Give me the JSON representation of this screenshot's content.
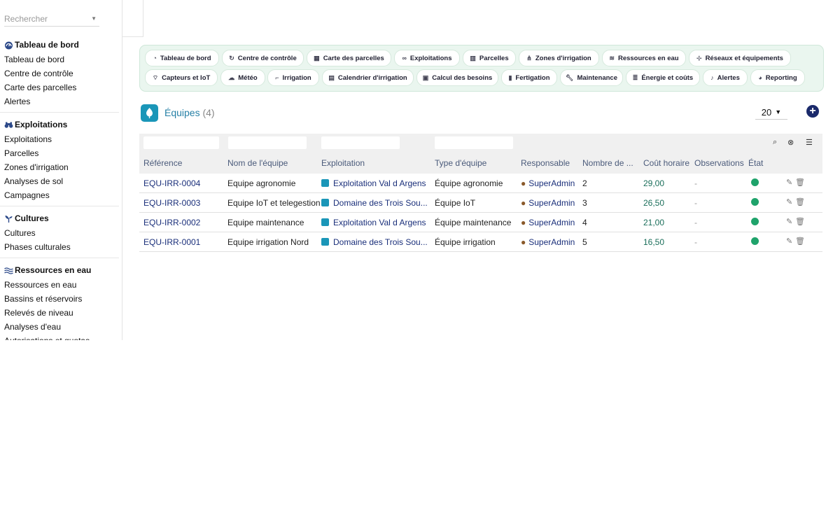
{
  "sidebar": {
    "search_placeholder": "Rechercher",
    "sections": [
      {
        "title": "Tableau de bord",
        "icon": "dashboard-icon",
        "items": [
          "Tableau de bord",
          "Centre de contrôle",
          "Carte des parcelles",
          "Alertes"
        ]
      },
      {
        "title": "Exploitations",
        "icon": "binoculars-icon",
        "items": [
          "Exploitations",
          "Parcelles",
          "Zones d'irrigation",
          "Analyses de sol",
          "Campagnes"
        ]
      },
      {
        "title": "Cultures",
        "icon": "seedling-icon",
        "items": [
          "Cultures",
          "Phases culturales"
        ]
      },
      {
        "title": "Ressources en eau",
        "icon": "water-icon",
        "items": [
          "Ressources en eau",
          "Bassins et réservoirs",
          "Relevés de niveau",
          "Analyses d'eau",
          "Autorisations et quotas"
        ]
      }
    ]
  },
  "nav": {
    "row1": [
      "Tableau de bord",
      "Centre de contrôle",
      "Carte des parcelles",
      "Exploitations",
      "Parcelles",
      "Zones d'irrigation",
      "Ressources en eau",
      "Réseaux et équipements"
    ],
    "row2": [
      "Capteurs et IoT",
      "Météo",
      "Irrigation",
      "Calendrier d'irrigation",
      "Calcul des besoins",
      "Fertigation",
      "Maintenance",
      "Énergie et coûts",
      "Alertes",
      "Reporting"
    ]
  },
  "page": {
    "title": "Équipes",
    "count": "(4)",
    "page_size": "20"
  },
  "table": {
    "columns": [
      "Référence",
      "Nom de l'équipe",
      "Exploitation",
      "Type d'équipe",
      "Responsable",
      "Nombre de ...",
      "Coût horaire",
      "Observations",
      "État"
    ],
    "rows": [
      {
        "ref": "EQU-IRR-0004",
        "name": "Equipe agronomie",
        "exploitation": "Exploitation Val d Argens",
        "type": "Équipe agronomie",
        "responsable": "SuperAdmin",
        "nombre": "2",
        "cout": "29,00",
        "obs": "-"
      },
      {
        "ref": "EQU-IRR-0003",
        "name": "Equipe IoT et telegestion",
        "exploitation": "Domaine des Trois Sou...",
        "type": "Équipe IoT",
        "responsable": "SuperAdmin",
        "nombre": "3",
        "cout": "26,50",
        "obs": "-"
      },
      {
        "ref": "EQU-IRR-0002",
        "name": "Equipe maintenance",
        "exploitation": "Exploitation Val d Argens",
        "type": "Équipe maintenance",
        "responsable": "SuperAdmin",
        "nombre": "4",
        "cout": "21,00",
        "obs": "-"
      },
      {
        "ref": "EQU-IRR-0001",
        "name": "Equipe irrigation Nord",
        "exploitation": "Domaine des Trois Sou...",
        "type": "Équipe irrigation",
        "responsable": "SuperAdmin",
        "nombre": "5",
        "cout": "16,50",
        "obs": "-"
      }
    ],
    "status_color": "#1fa36b"
  }
}
